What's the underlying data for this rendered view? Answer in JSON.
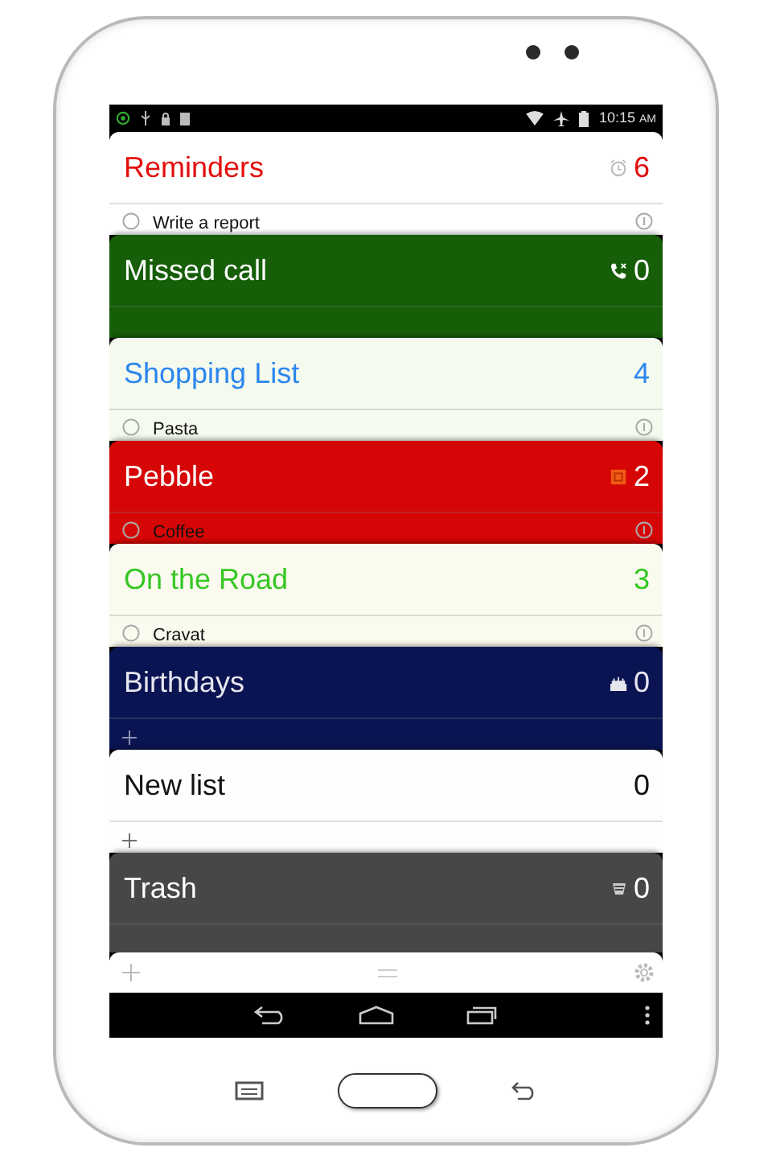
{
  "status_bar": {
    "time": "10:15",
    "period": "AM"
  },
  "lists": [
    {
      "kind": "alarm",
      "color": "#ffffff",
      "title": {
        "text": "Reminders",
        "color": "#e30d0d"
      },
      "count": "6",
      "peek": {
        "kind": "item",
        "text": "Write a report"
      }
    },
    {
      "kind": "phone",
      "color": "#165e08",
      "title": {
        "text": "Missed call",
        "color": "#ffffff"
      },
      "count": "0",
      "peek": {
        "kind": "empty"
      }
    },
    {
      "kind": "plain",
      "color": "#f5faee",
      "title": {
        "text": "Shopping List",
        "color": "#2b86ee"
      },
      "count": "4",
      "peek": {
        "kind": "item",
        "text": "Pasta"
      }
    },
    {
      "kind": "watch",
      "color": "#d70606",
      "title": {
        "text": "Pebble",
        "color": "#ffffff"
      },
      "count": "2",
      "peek": {
        "kind": "item",
        "text": "Coffee"
      }
    },
    {
      "kind": "plain",
      "color": "#fbfaee",
      "title": {
        "text": "On the Road",
        "color": "#35c723"
      },
      "count": "3",
      "peek": {
        "kind": "item",
        "text": "Cravat"
      }
    },
    {
      "kind": "cake",
      "color": "#0a1452",
      "title": {
        "text": "Birthdays",
        "color": "#e6e6ee"
      },
      "count": "0",
      "peek": {
        "kind": "add"
      }
    },
    {
      "kind": "plain",
      "color": "#fefefe",
      "title": {
        "text": "New list",
        "color": "#111111"
      },
      "count": "0",
      "peek": {
        "kind": "add"
      }
    },
    {
      "kind": "trash",
      "color": "#474747",
      "title": {
        "text": "Trash",
        "color": "#ffffff"
      },
      "count": "0",
      "peek": {
        "kind": "empty"
      }
    }
  ]
}
